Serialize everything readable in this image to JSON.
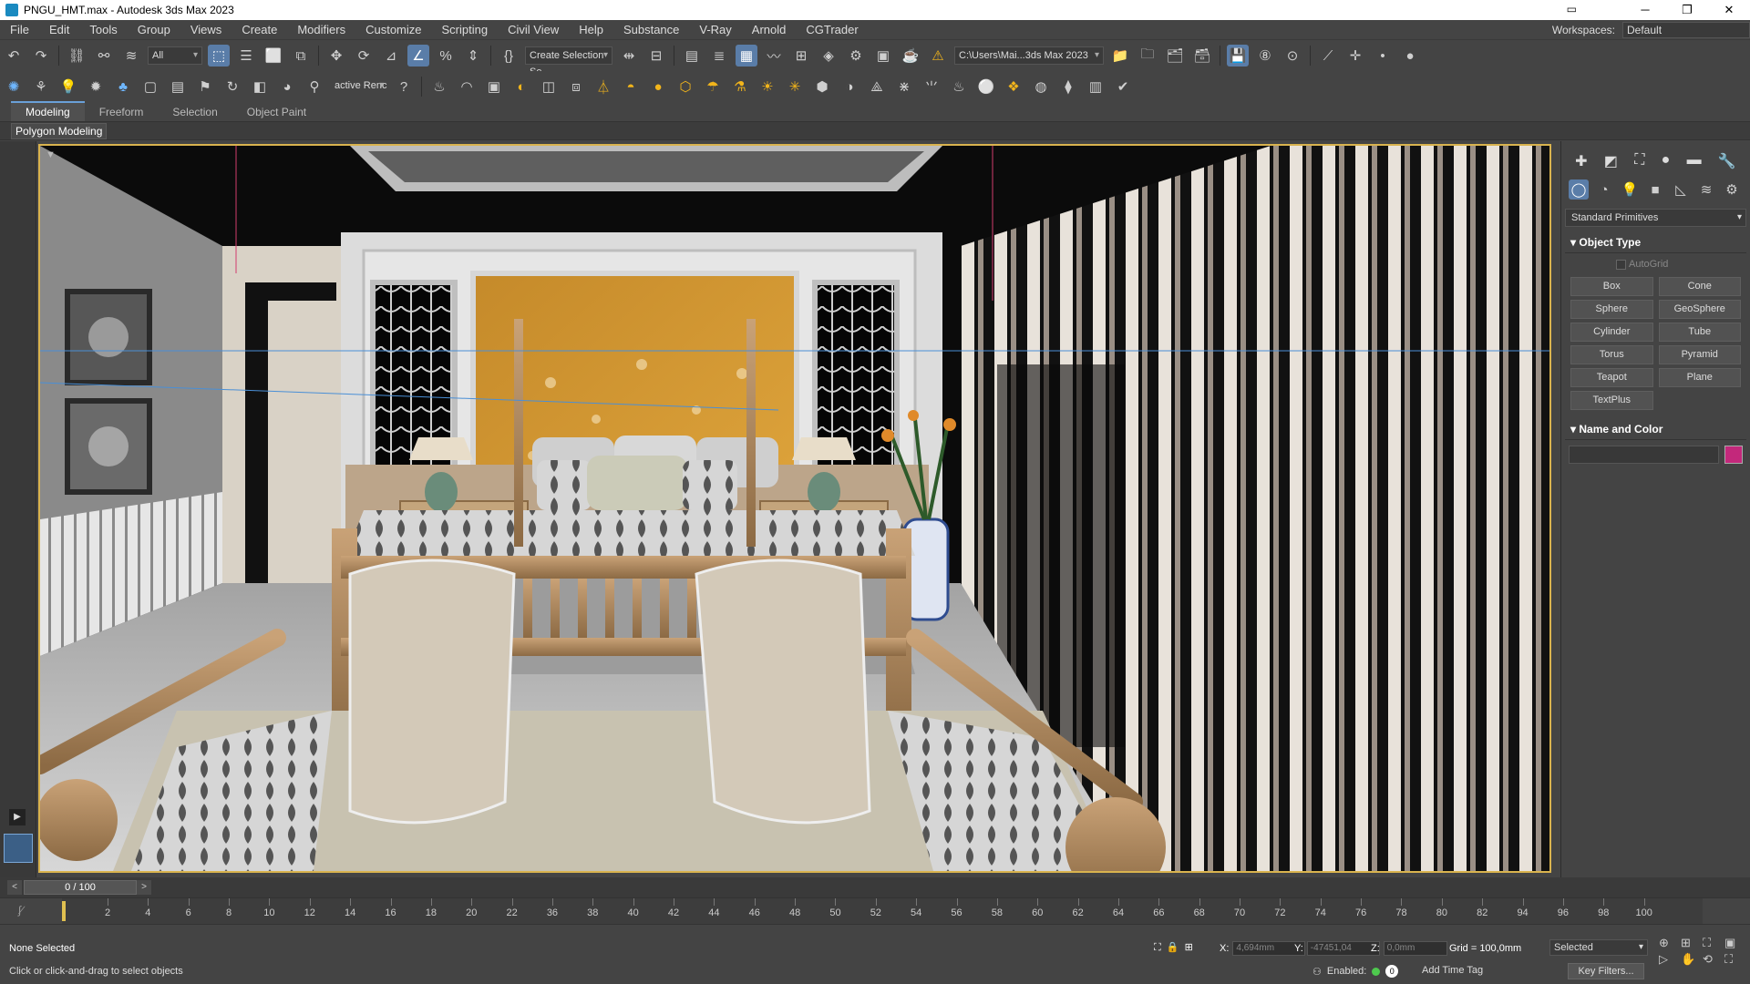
{
  "window": {
    "title": "PNGU_HMT.max - Autodesk 3ds Max 2023",
    "minimize": "─",
    "maximize": "❐",
    "close": "✕"
  },
  "menu": [
    "File",
    "Edit",
    "Tools",
    "Group",
    "Views",
    "Create",
    "Modifiers",
    "Customize",
    "Scripting",
    "Civil View",
    "Help",
    "Substance",
    "V-Ray",
    "Arnold",
    "CGTrader"
  ],
  "workspaces": {
    "label": "Workspaces:",
    "value": "Default"
  },
  "toolbar": {
    "selection_filter": "All",
    "named_selection": "Create Selection Se",
    "path": "C:\\Users\\Mai...3ds Max 2023",
    "active_render": "active Renc"
  },
  "ribbon": {
    "tabs": [
      "Modeling",
      "Freeform",
      "Selection",
      "Object Paint"
    ],
    "sub_label": "Polygon Modeling"
  },
  "create_panel": {
    "dropdown": "Standard Primitives",
    "object_type_header": "Object Type",
    "autogrid": "AutoGrid",
    "buttons": [
      "Box",
      "Cone",
      "Sphere",
      "GeoSphere",
      "Cylinder",
      "Tube",
      "Torus",
      "Pyramid",
      "Teapot",
      "Plane",
      "TextPlus"
    ],
    "name_color_header": "Name and Color",
    "swatch_color": "#c3287b"
  },
  "timeline": {
    "frame_display": "0 / 100",
    "ticks": [
      "2",
      "4",
      "6",
      "8",
      "10",
      "12",
      "14",
      "16",
      "18",
      "20",
      "22",
      "36",
      "38",
      "40",
      "42",
      "44",
      "46",
      "48",
      "50",
      "52",
      "54",
      "56",
      "58",
      "60",
      "62",
      "64",
      "66",
      "68",
      "70",
      "72",
      "74",
      "76",
      "78",
      "80",
      "82",
      "94",
      "96",
      "98",
      "100"
    ]
  },
  "status": {
    "selection": "None Selected",
    "prompt": "Click or click-and-drag to select objects",
    "x_label": "X:",
    "x_value": "4,694mm",
    "y_label": "Y:",
    "y_value": "-47451,04",
    "z_label": "Z:",
    "z_value": "0,0mm",
    "grid": "Grid = 100,0mm",
    "selected_dropdown": "Selected",
    "enabled_label": "Enabled:",
    "enabled_value": "0",
    "add_time_tag": "Add Time Tag",
    "key_filters": "Key Filters..."
  }
}
